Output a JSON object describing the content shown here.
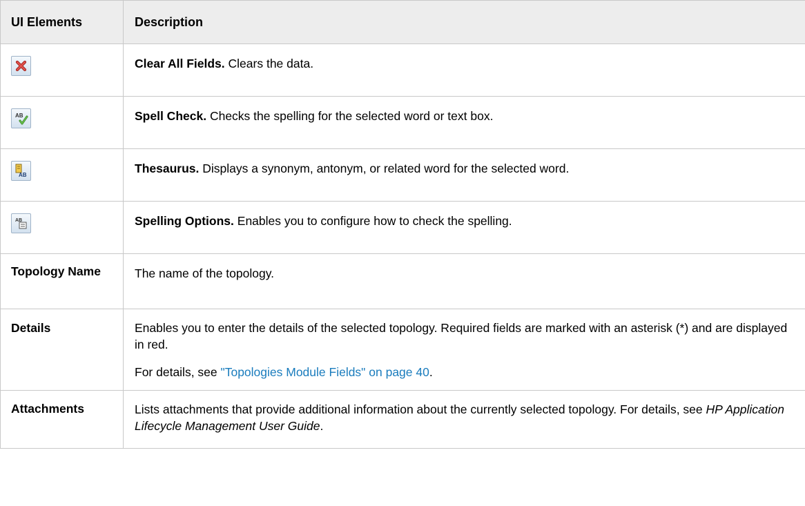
{
  "header": {
    "col_elements": "UI Elements",
    "col_description": "Description"
  },
  "rows": [
    {
      "icon": "clear-all-fields-icon",
      "title": "Clear All Fields.",
      "text": "Clears the data."
    },
    {
      "icon": "spell-check-icon",
      "title": "Spell Check.",
      "text": "Checks the spelling for the selected word or text box."
    },
    {
      "icon": "thesaurus-icon",
      "title": "Thesaurus.",
      "text": "Displays a synonym, antonym, or related word for the selected word."
    },
    {
      "icon": "spelling-options-icon",
      "title": "Spelling Options.",
      "text": "Enables you to configure how to check the spelling."
    },
    {
      "element": "Topology Name",
      "text": "The name of the topology."
    },
    {
      "element": "Details",
      "text": "Enables you to enter the details of the selected topology. Required fields are marked with an asterisk (*) and are displayed in red.",
      "text2_prefix": "For details, see ",
      "text2_link": "\"Topologies Module Fields\" on page 40",
      "text2_suffix": "."
    },
    {
      "element": "Attachments",
      "text_prefix": "Lists attachments that provide additional information about the currently selected topology. For details, see ",
      "text_italic": "HP Application Lifecycle Management User Guide",
      "text_suffix": "."
    }
  ],
  "colors": {
    "header_bg": "#ededed",
    "border": "#c8c8c8",
    "link": "#1a7cbd",
    "icon_bg": "#d3e1ef",
    "clear_icon": "#d9413a",
    "check_icon": "#3f9b2f"
  }
}
